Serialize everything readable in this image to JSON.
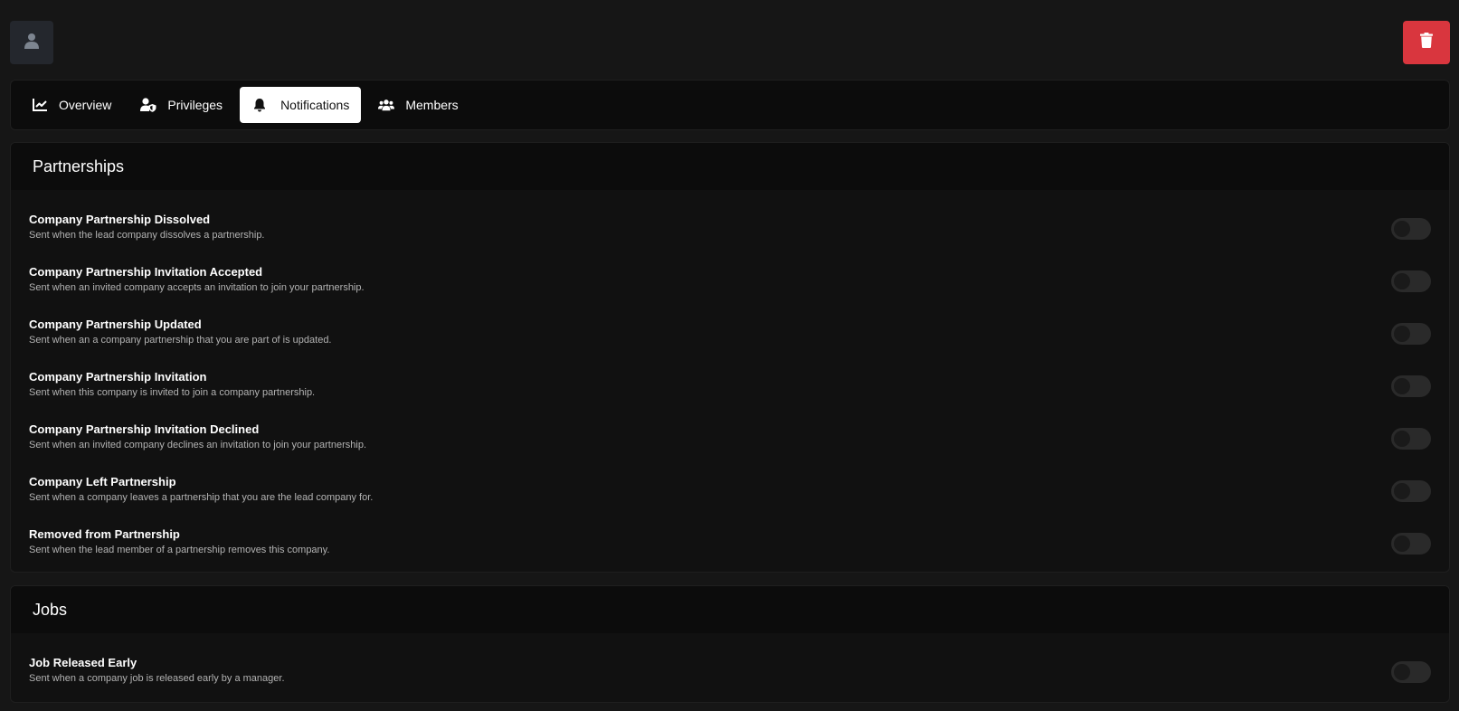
{
  "header": {
    "avatar_icon": "user-icon",
    "delete_icon": "trash-icon",
    "delete_color": "#d9363e"
  },
  "tabs": [
    {
      "label": "Overview",
      "icon": "chart-line-icon",
      "active": false
    },
    {
      "label": "Privileges",
      "icon": "user-shield-icon",
      "active": false
    },
    {
      "label": "Notifications",
      "icon": "bell-icon",
      "active": true
    },
    {
      "label": "Members",
      "icon": "users-icon",
      "active": false
    }
  ],
  "sections": [
    {
      "title": "Partnerships",
      "items": [
        {
          "title": "Company Partnership Dissolved",
          "description": "Sent when the lead company dissolves a partnership.",
          "enabled": false
        },
        {
          "title": "Company Partnership Invitation Accepted",
          "description": "Sent when an invited company accepts an invitation to join your partnership.",
          "enabled": false
        },
        {
          "title": "Company Partnership Updated",
          "description": "Sent when an a company partnership that you are part of is updated.",
          "enabled": false
        },
        {
          "title": "Company Partnership Invitation",
          "description": "Sent when this company is invited to join a company partnership.",
          "enabled": false
        },
        {
          "title": "Company Partnership Invitation Declined",
          "description": "Sent when an invited company declines an invitation to join your partnership.",
          "enabled": false
        },
        {
          "title": "Company Left Partnership",
          "description": "Sent when a company leaves a partnership that you are the lead company for.",
          "enabled": false
        },
        {
          "title": "Removed from Partnership",
          "description": "Sent when the lead member of a partnership removes this company.",
          "enabled": false
        }
      ]
    },
    {
      "title": "Jobs",
      "items": [
        {
          "title": "Job Released Early",
          "description": "Sent when a company job is released early by a manager.",
          "enabled": false
        }
      ]
    }
  ]
}
